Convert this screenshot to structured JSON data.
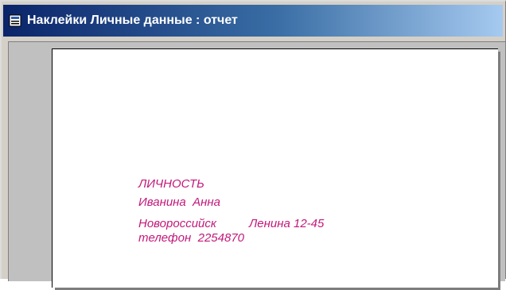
{
  "window": {
    "title": "Наклейки Личные данные : отчет",
    "icon": "report-icon"
  },
  "label": {
    "heading": "ЛИЧНОСТЬ",
    "name": "Иванина  Анна",
    "city": "Новороссийск",
    "street": "Ленина 12-45",
    "phone": "телефон  2254870"
  },
  "colors": {
    "title_bar_start": "#0a246a",
    "title_bar_end": "#a6caf0",
    "label_text": "#c2187a",
    "preview_background": "#c0c0c0"
  }
}
